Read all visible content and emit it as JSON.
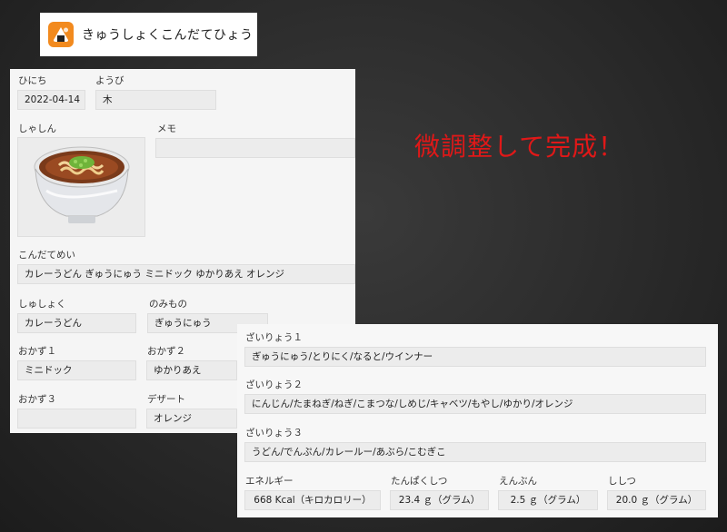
{
  "app": {
    "title": "きゅうしょくこんだてひょう",
    "icon": "onigiri-icon",
    "accent": "#f28a1e"
  },
  "headline": "微調整して完成！",
  "menu": {
    "date_label": "ひにち",
    "date_value": "2022-04-14",
    "weekday_label": "ようび",
    "weekday_value": "木",
    "photo_label": "しゃしん",
    "photo_icon": "curry-udon-bowl-icon",
    "memo_label": "メモ",
    "memo_value": "",
    "menu_name_label": "こんだてめい",
    "menu_name_value": "カレーうどん ぎゅうにゅう ミニドック ゆかりあえ  オレンジ",
    "staple_label": "しゅしょく",
    "staple_value": "カレーうどん",
    "drink_label": "のみもの",
    "drink_value": "ぎゅうにゅう",
    "side1_label": "おかず１",
    "side1_value": "ミニドック",
    "side2_label": "おかず２",
    "side2_value": "ゆかりあえ",
    "side3_label": "おかず３",
    "side3_value": "",
    "dessert_label": "デザート",
    "dessert_value": "オレンジ"
  },
  "ingredients": {
    "group1_label": "ざいりょう１",
    "group1_value": "ぎゅうにゅう/とりにく/なると/ウインナー",
    "group2_label": "ざいりょう２",
    "group2_value": "にんじん/たまねぎ/ねぎ/こまつな/しめじ/キャベツ/もやし/ゆかり/オレンジ",
    "group3_label": "ざいりょう３",
    "group3_value": "うどん/でんぷん/カレールー/あぶら/こむぎこ"
  },
  "nutrition": {
    "energy_label": "エネルギー",
    "energy_value": "668 Kcal（キロカロリー）",
    "protein_label": "たんぱくしつ",
    "protein_value": "23.4 ｇ（グラム）",
    "salt_label": "えんぶん",
    "salt_value": "2.5 ｇ（グラム）",
    "fat_label": "ししつ",
    "fat_value": "20.0 ｇ（グラム）"
  }
}
